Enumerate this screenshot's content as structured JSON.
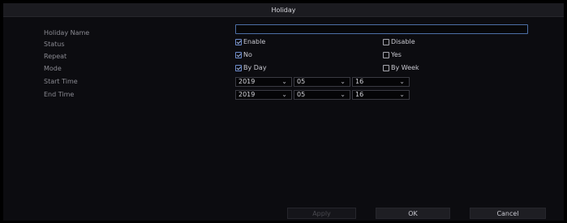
{
  "dialog": {
    "title": "Holiday"
  },
  "labels": {
    "holiday_name": "Holiday Name",
    "status": "Status",
    "repeat": "Repeat",
    "mode": "Mode",
    "start_time": "Start Time",
    "end_time": "End Time"
  },
  "holiday_name_value": "",
  "options": {
    "status": {
      "enable": "Enable",
      "disable": "Disable",
      "selected": "Enable"
    },
    "repeat": {
      "no": "No",
      "yes": "Yes",
      "selected": "No"
    },
    "mode": {
      "by_day": "By Day",
      "by_week": "By Week",
      "selected": "By Day"
    }
  },
  "start_time": {
    "year": "2019",
    "month": "05",
    "day": "16"
  },
  "end_time": {
    "year": "2019",
    "month": "05",
    "day": "16"
  },
  "buttons": {
    "apply": "Apply",
    "ok": "OK",
    "cancel": "Cancel"
  },
  "icons": {
    "dropdown": "chevron-down-icon",
    "checkbox": "checkbox-icon"
  },
  "colors": {
    "accent": "#4d6fa6",
    "background": "#0c0c10",
    "titlebar": "#1b1b20"
  }
}
